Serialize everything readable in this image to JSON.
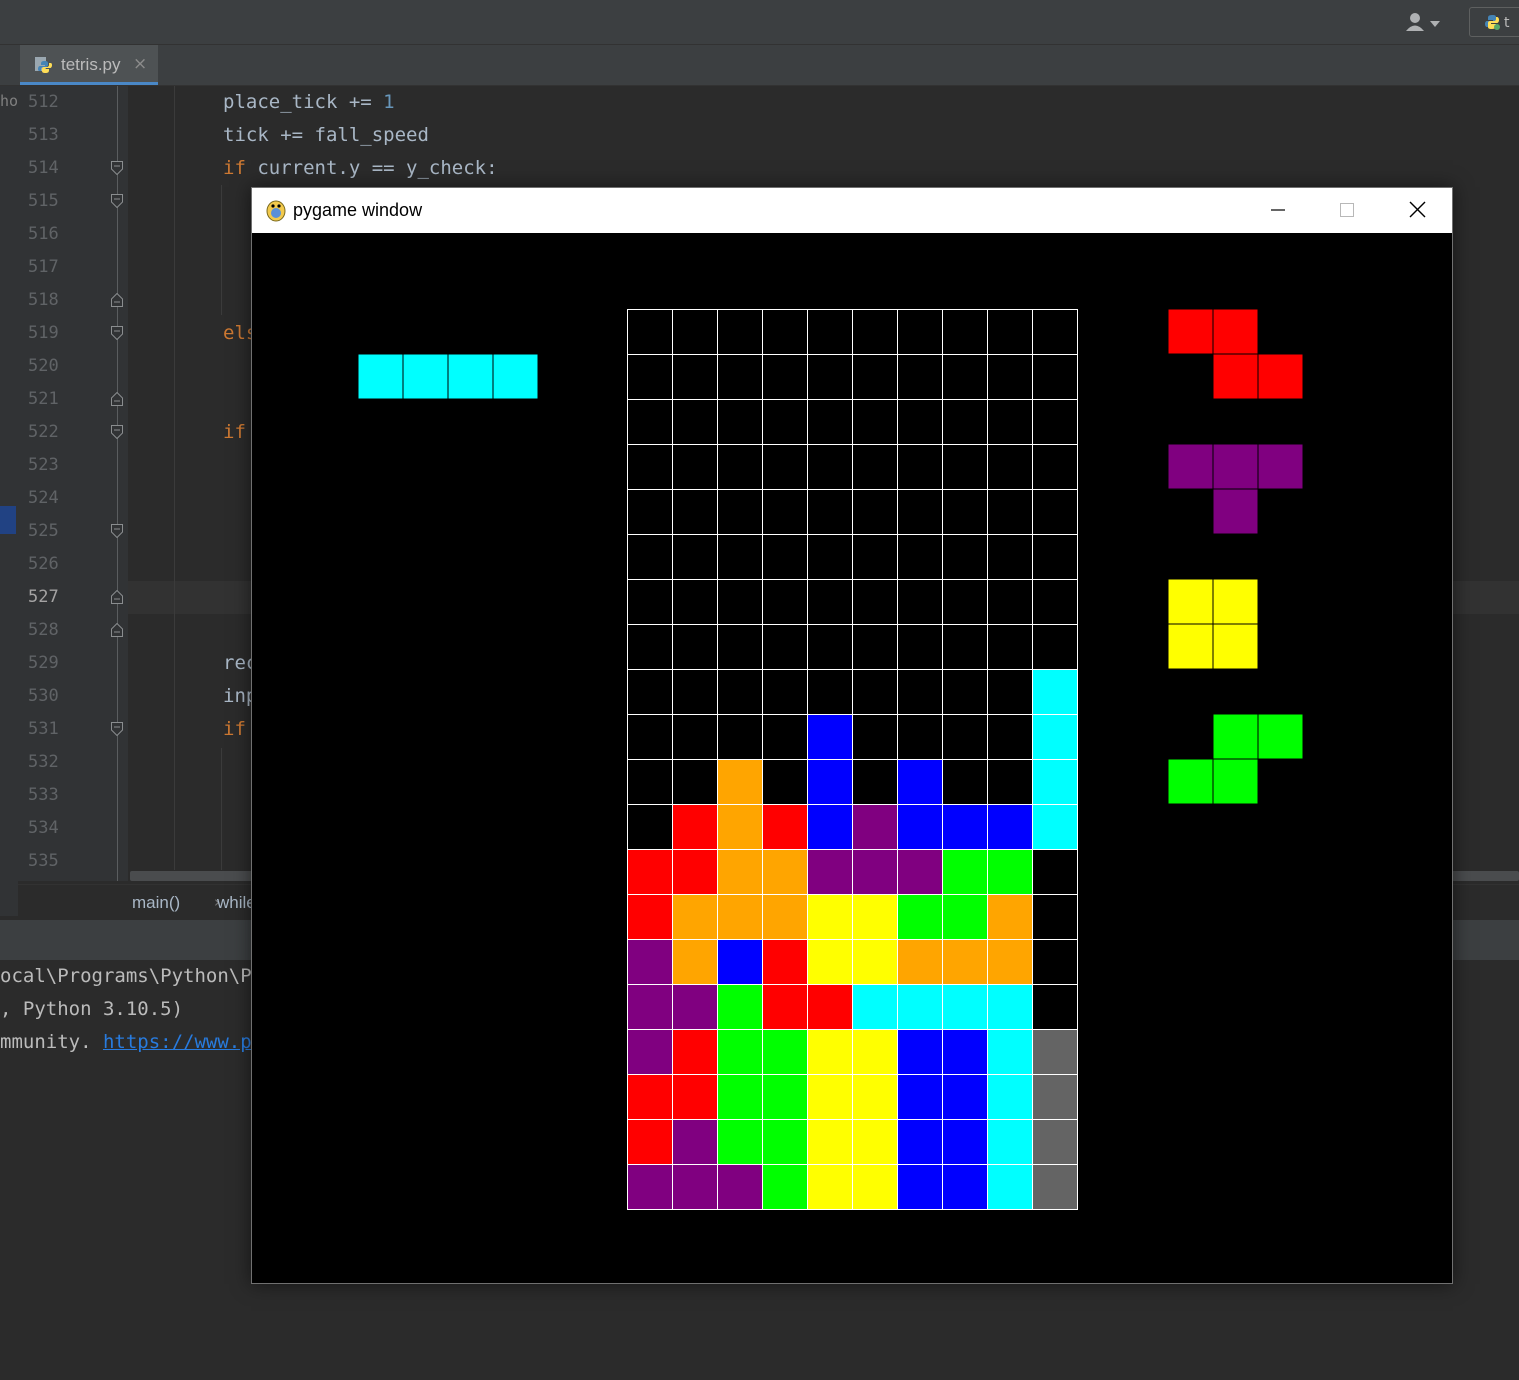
{
  "ide": {
    "left_stub_text": "ho",
    "tab": {
      "label": "tetris.py",
      "close": "×",
      "icon": "python-file-icon"
    },
    "run_config": {
      "label": "t",
      "icon": "python-icon"
    },
    "user_menu_icon": "user-dropdown-icon",
    "line_numbers": [
      "512",
      "513",
      "514",
      "515",
      "516",
      "517",
      "518",
      "519",
      "520",
      "521",
      "522",
      "523",
      "524",
      "525",
      "526",
      "527",
      "528",
      "529",
      "530",
      "531",
      "532",
      "533",
      "534",
      "535"
    ],
    "current_line": "527",
    "code": {
      "line_512": "place_tick += 1",
      "line_512_var": "place_tick += ",
      "line_512_num": "1",
      "line_513": "tick += fall_speed",
      "line_514_kw": "if",
      "line_514_rest": " current.y == y_check:",
      "line_519_partial": "els",
      "line_522_partial": "if",
      "line_529_partial": "rec",
      "line_530_partial": "inp",
      "line_531_partial": "if"
    },
    "breadcrumbs": [
      "main()",
      "while"
    ],
    "breadcrumb_separator": "›",
    "console": {
      "line1": "ocal\\Programs\\Python\\P",
      "line2": ", Python 3.10.5)",
      "line3_text": "mmunity. ",
      "line3_link": "https://www.p"
    }
  },
  "pygame_window": {
    "title": "pygame window",
    "controls": [
      "minimize",
      "maximize",
      "close"
    ]
  },
  "tetris": {
    "colors": {
      "C": "#00ffff",
      "B": "#0000ff",
      "O": "#ffa500",
      "Y": "#ffff00",
      "G": "#00ff00",
      "P": "#800080",
      "R": "#ff0000",
      "X": "#646464"
    },
    "board": [
      "..........",
      "..........",
      "..........",
      "..........",
      "..........",
      "..........",
      "..........",
      "..........",
      ".........C",
      "....B....C",
      "..O.B.B..C",
      ".RORBPBBBC",
      "RROOPPPGG.",
      "ROOOYYGGO.",
      "POBRYYOOO.",
      "PPGRRCCCC.",
      "PRGGYYBBCX",
      "RRGGYYBBCX",
      "RPGGYYBBCX",
      "PPPGYYBBCX"
    ],
    "hold_piece": {
      "shape": [
        "CCCC"
      ]
    },
    "next_pieces": [
      {
        "shape": [
          "RR.",
          ".RR"
        ]
      },
      {
        "shape": [
          "PPP",
          ".P."
        ]
      },
      {
        "shape": [
          "YY",
          "YY"
        ]
      },
      {
        "shape": [
          ".GG",
          "GG."
        ]
      }
    ]
  }
}
